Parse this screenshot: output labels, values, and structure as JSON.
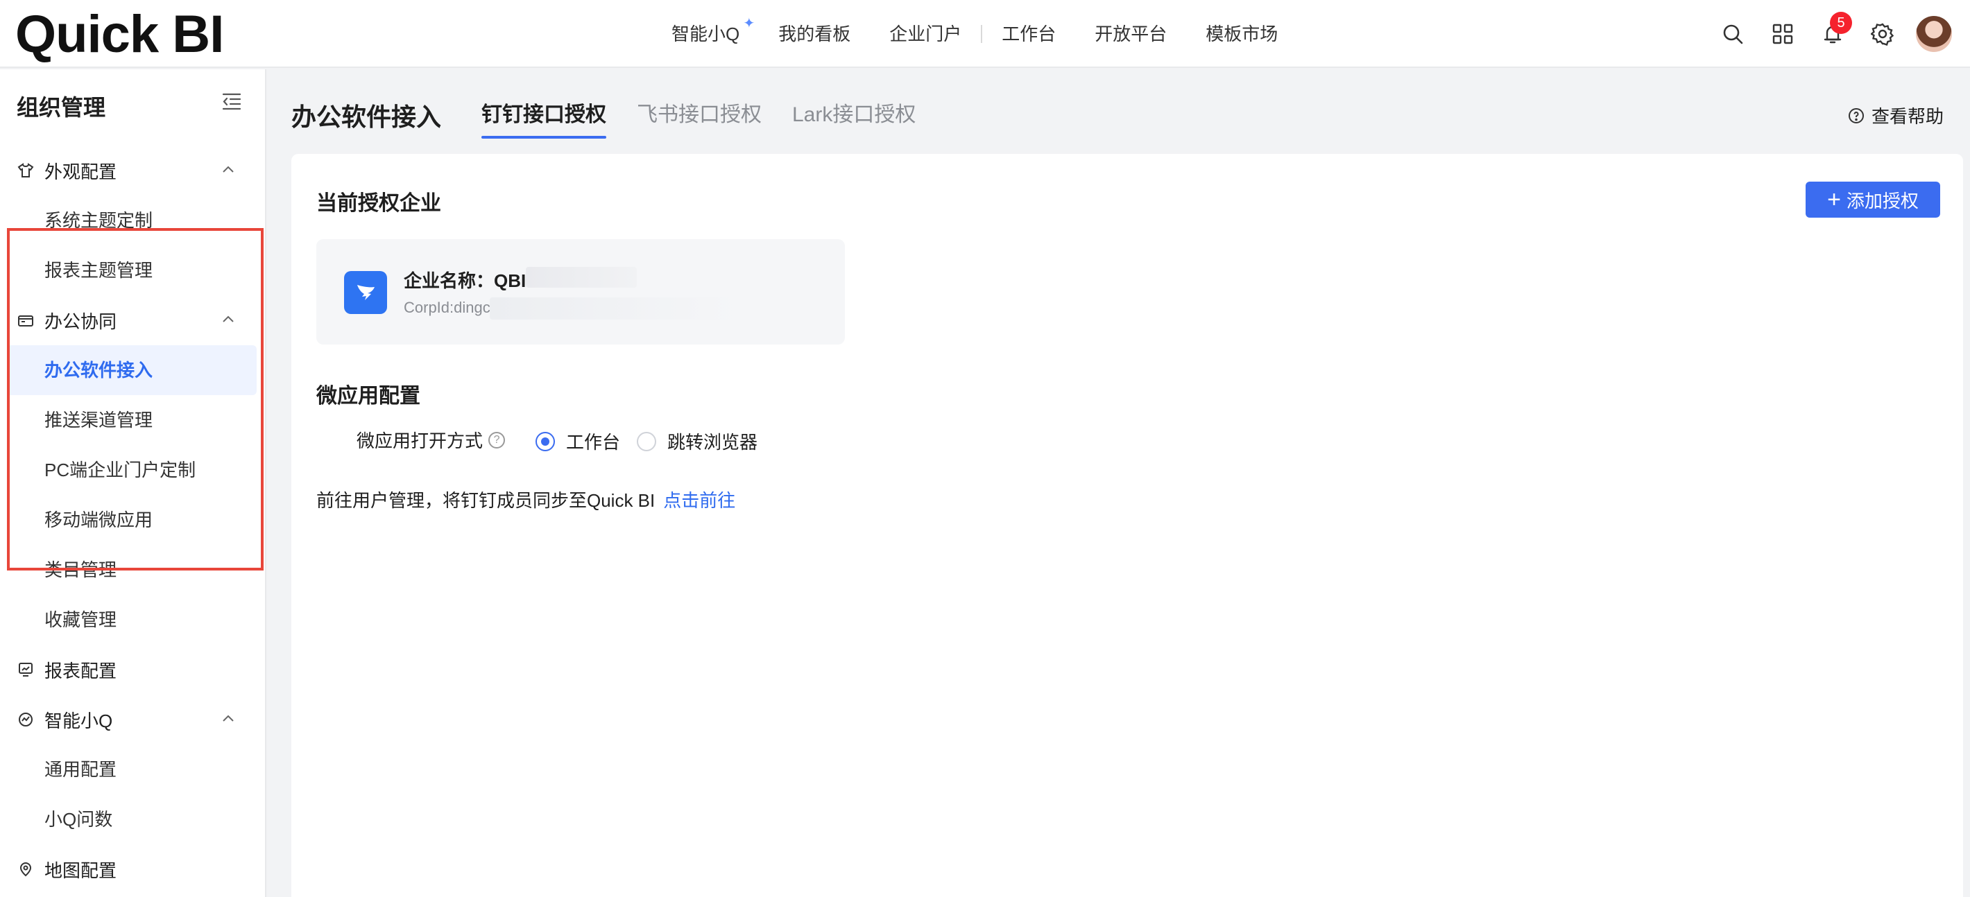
{
  "header": {
    "logo": "Quick BI",
    "nav": [
      "智能小Q",
      "我的看板",
      "企业门户",
      "工作台",
      "开放平台",
      "模板市场"
    ],
    "notification_count": "5",
    "icons": [
      "search-icon",
      "apps-grid-icon",
      "bell-icon",
      "settings-icon"
    ]
  },
  "sidebar": {
    "title": "组织管理",
    "groups": [
      {
        "label": "外观配置",
        "icon": "shirt-icon",
        "items": [
          "系统主题定制",
          "报表主题管理"
        ]
      },
      {
        "label": "办公协同",
        "icon": "briefcase-icon",
        "items": [
          "办公软件接入",
          "推送渠道管理",
          "PC端企业门户定制",
          "移动端微应用",
          "类目管理",
          "收藏管理"
        ]
      },
      {
        "label": "报表配置",
        "icon": "report-icon",
        "items": []
      },
      {
        "label": "智能小Q",
        "icon": "ai-icon",
        "items": [
          "通用配置",
          "小Q问数"
        ]
      },
      {
        "label": "地图配置",
        "icon": "map-pin-icon",
        "items": []
      }
    ],
    "active_item": "办公软件接入"
  },
  "main": {
    "title": "办公软件接入",
    "tabs": [
      "钉钉接口授权",
      "飞书接口授权",
      "Lark接口授权"
    ],
    "active_tab": "钉钉接口授权",
    "help": "查看帮助",
    "current_enterprise_title": "当前授权企业",
    "add_button": "添加授权",
    "enterprise": {
      "name_label": "企业名称：QBI",
      "corp_id": "CorpId:dingc"
    },
    "micro_app_title": "微应用配置",
    "open_mode_label": "微应用打开方式",
    "open_mode_options": [
      "工作台",
      "跳转浏览器"
    ],
    "open_mode_selected": "工作台",
    "sync_text": "前往用户管理，将钉钉成员同步至Quick BI",
    "sync_link": "点击前往"
  }
}
